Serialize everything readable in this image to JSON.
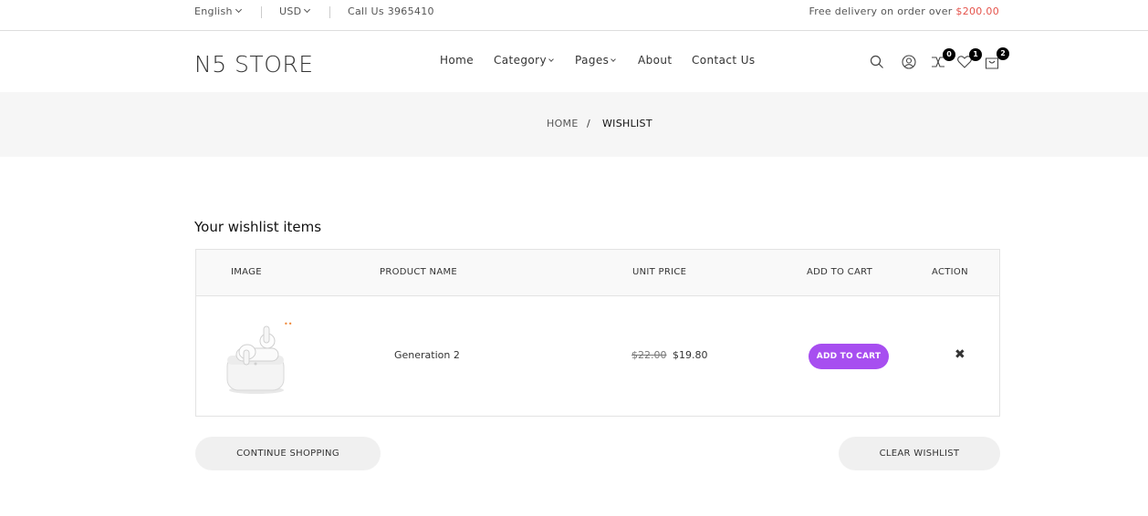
{
  "topbar": {
    "language": "English",
    "currency": "USD",
    "call": "Call Us 3965410",
    "free_delivery_text": "Free delivery on order over ",
    "free_delivery_amount": "$200.00"
  },
  "header": {
    "logo": "N5 STORE",
    "nav": [
      "Home",
      "Category",
      "Pages",
      "About",
      "Contact Us"
    ],
    "badges": {
      "compare": "0",
      "wishlist": "1",
      "cart": "2"
    }
  },
  "breadcrumb": {
    "home": "HOME",
    "separator": "/",
    "current": "WISHLIST"
  },
  "wishlist": {
    "title": "Your wishlist items",
    "columns": [
      "IMAGE",
      "PRODUCT NAME",
      "UNIT PRICE",
      "ADD TO CART",
      "ACTION"
    ],
    "items": [
      {
        "name": "Generation 2",
        "old_price": "$22.00",
        "price": "$19.80",
        "add_label": "ADD TO CART",
        "remove": "✖"
      }
    ],
    "continue_label": "CONTINUE SHOPPING",
    "clear_label": "CLEAR WISHLIST"
  },
  "colors": {
    "accent": "#a74ef0",
    "sale": "#e5534b",
    "band": "#f6f6f6"
  },
  "icons": [
    "search-icon",
    "user-icon",
    "compare-icon",
    "heart-icon",
    "bag-icon",
    "close-icon"
  ]
}
